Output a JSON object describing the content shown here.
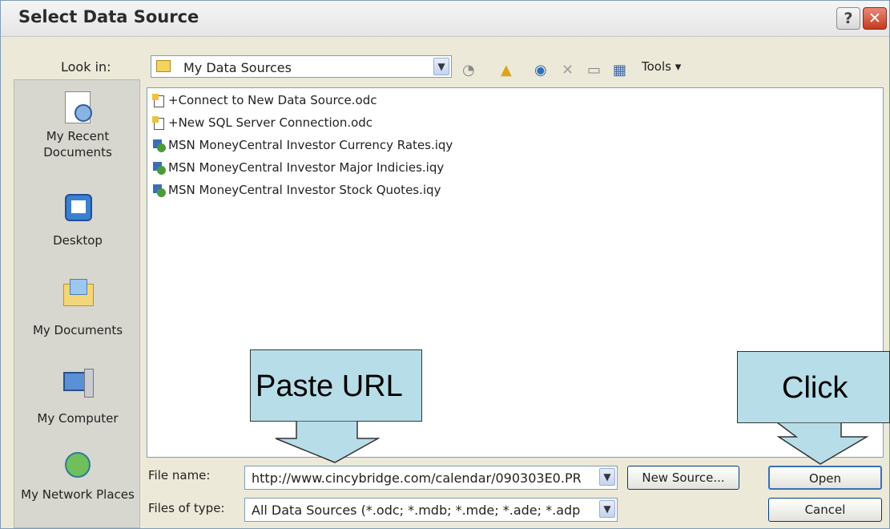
{
  "window": {
    "title": "Select Data Source",
    "help": "?",
    "close": "✕"
  },
  "lookin": {
    "label": "Look in:",
    "value": "My Data Sources",
    "tools_label": "Tools ▾"
  },
  "places": [
    {
      "label": "My Recent Documents",
      "icon": "recent-documents-icon"
    },
    {
      "label": "Desktop",
      "icon": "desktop-icon"
    },
    {
      "label": "My Documents",
      "icon": "my-documents-icon"
    },
    {
      "label": "My Computer",
      "icon": "my-computer-icon"
    },
    {
      "label": "My Network Places",
      "icon": "network-places-icon"
    }
  ],
  "files": [
    "+Connect to New Data Source.odc",
    "+New SQL Server Connection.odc",
    "MSN MoneyCentral Investor Currency Rates.iqy",
    "MSN MoneyCentral Investor Major Indicies.iqy",
    "MSN MoneyCentral Investor Stock Quotes.iqy"
  ],
  "filename": {
    "label": "File name:",
    "value": "http://www.cincybridge.com/calendar/090303E0.PR"
  },
  "filetype": {
    "label": "Files of type:",
    "value": "All Data Sources (*.odc; *.mdb; *.mde; *.ade; *.adp"
  },
  "buttons": {
    "new_source": "New Source...",
    "open": "Open",
    "cancel": "Cancel"
  },
  "callouts": {
    "paste": "Paste URL",
    "click": "Click"
  }
}
